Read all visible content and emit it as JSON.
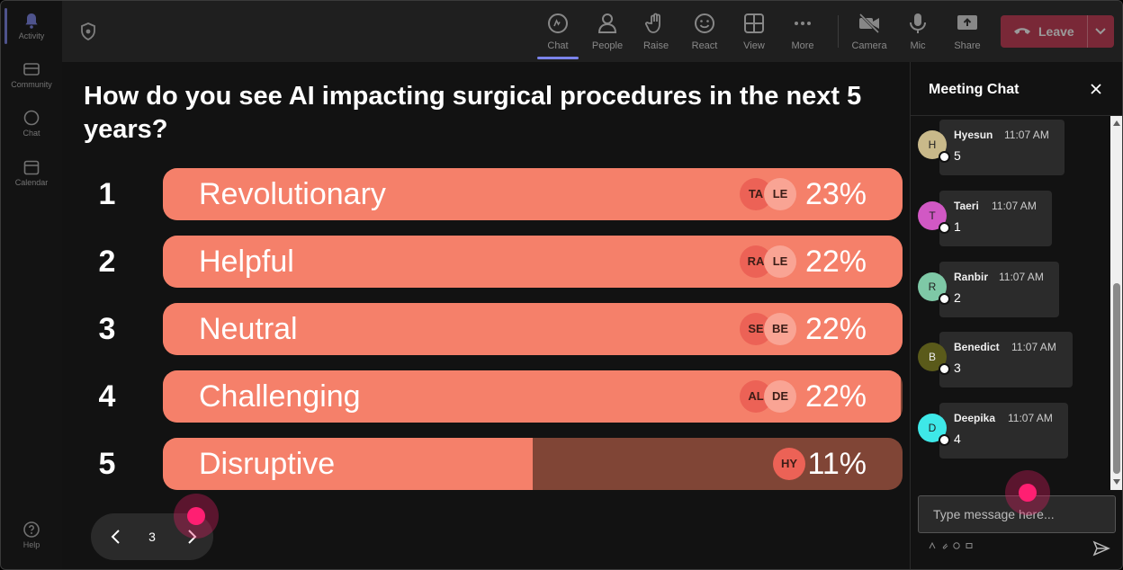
{
  "rail": {
    "items": [
      {
        "label": "Activity",
        "icon": "bell-icon"
      },
      {
        "label": "Community",
        "icon": "community-icon"
      },
      {
        "label": "Chat",
        "icon": "chat-icon"
      },
      {
        "label": "Calendar",
        "icon": "calendar-icon"
      },
      {
        "label": "Help",
        "icon": "help-icon"
      }
    ]
  },
  "toolbar": {
    "chat": "Chat",
    "people": "People",
    "raise": "Raise",
    "react": "React",
    "view": "View",
    "more": "More",
    "camera": "Camera",
    "mic": "Mic",
    "share": "Share",
    "leave": "Leave"
  },
  "poll": {
    "question": "How do you see AI impacting surgical procedures in the next 5 years?",
    "options": [
      {
        "num": "1",
        "label": "Revolutionary",
        "percent": "23%",
        "fill": 100,
        "voters": [
          "TA",
          "LE"
        ]
      },
      {
        "num": "2",
        "label": "Helpful",
        "percent": "22%",
        "fill": 100,
        "voters": [
          "RA",
          "LE"
        ]
      },
      {
        "num": "3",
        "label": "Neutral",
        "percent": "22%",
        "fill": 100,
        "voters": [
          "SE",
          "BE"
        ]
      },
      {
        "num": "4",
        "label": "Challenging",
        "percent": "22%",
        "fill": 99.8,
        "voters": [
          "AL",
          "DE"
        ]
      },
      {
        "num": "5",
        "label": "Disruptive",
        "percent": "11%",
        "fill": 50,
        "voters": [
          "HY"
        ]
      }
    ],
    "page": "3"
  },
  "chat": {
    "title": "Meeting Chat",
    "messages": [
      {
        "initial": "H",
        "name": "Hyesun",
        "time": "11:07 AM",
        "text": "5",
        "color": "#c9b98a"
      },
      {
        "initial": "T",
        "name": "Taeri",
        "time": "11:07 AM",
        "text": "1",
        "color": "#d158c4"
      },
      {
        "initial": "R",
        "name": "Ranbir",
        "time": "11:07 AM",
        "text": "2",
        "color": "#7ec8a6"
      },
      {
        "initial": "B",
        "name": "Benedict",
        "time": "11:07 AM",
        "text": "3",
        "color": "#5a5a1a"
      },
      {
        "initial": "D",
        "name": "Deepika",
        "time": "11:07 AM",
        "text": "4",
        "color": "#3ee8e8"
      }
    ],
    "input_placeholder": "Type message here..."
  },
  "colors": {
    "bar_fill": "#f5806a",
    "bar_track": "#804536",
    "leave": "#c4314b",
    "accent": "#7b83eb"
  }
}
